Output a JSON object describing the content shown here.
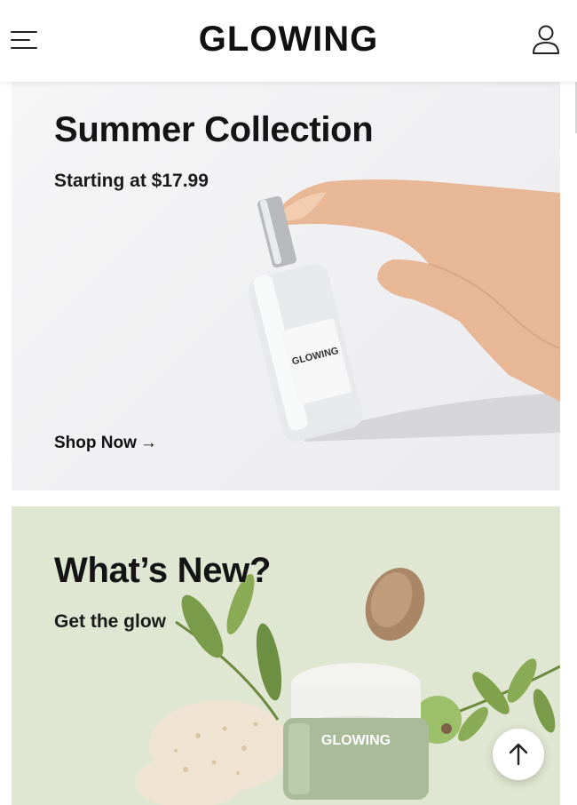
{
  "header": {
    "brand": "GLOWING",
    "menu_icon": "hamburger-menu-icon",
    "account_icon": "user-account-icon"
  },
  "banners": [
    {
      "title": "Summer Collection",
      "subtitle": "Starting at $17.99",
      "cta_label": "Shop Now",
      "cta_arrow": "→",
      "product_label": "GLOWING",
      "background": "#f1f1f3"
    },
    {
      "title": "What’s New?",
      "subtitle": "Get the glow",
      "product_label": "GLOWING",
      "background": "#dfe6d1"
    }
  ],
  "scroll_top_icon": "arrow-up-icon",
  "colors": {
    "text": "#141414",
    "summer_bg": "#f1f1f3",
    "new_bg": "#dfe6d1",
    "jar_green": "#a9bb98"
  }
}
